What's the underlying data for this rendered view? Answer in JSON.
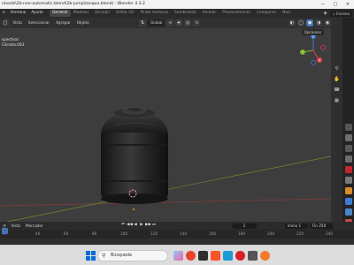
{
  "titlebar": {
    "title": "nloads\\2b-nee-automatic.blend\\2b-jump\\tanque.blend) - Blender 4.3.2",
    "minimize": "—",
    "maximize": "□",
    "close": "✕"
  },
  "menu": {
    "items": [
      "e",
      "Ventana",
      "Ayuda"
    ],
    "workspaces": [
      "General",
      "Modelar",
      "Esculpir",
      "Editar UV",
      "Pintar texturas",
      "Sombreado",
      "Animar",
      "Procesamiento",
      "Componer",
      "Nod"
    ],
    "active_workspace": "General",
    "scene": "Escena"
  },
  "viewport_header": {
    "menus": [
      "Vista",
      "Seleccionar",
      "Agregar",
      "Objeto"
    ],
    "transform": "Global",
    "options": "Opciones"
  },
  "viewport": {
    "info_line1": "spectival",
    "info_line2": "Cilindro.003",
    "axes": {
      "x": "X",
      "y": "Y",
      "z": "Z"
    }
  },
  "timeline": {
    "menus": [
      "Vista",
      "Marcador"
    ],
    "current_frame": "1",
    "start_label": "Inicio",
    "start": "1",
    "end_label": "Fin",
    "end": "250",
    "ruler": [
      "0",
      "40",
      "60",
      "80",
      "100",
      "120",
      "140",
      "160",
      "180",
      "200",
      "220",
      "240"
    ]
  },
  "taskbar": {
    "search_placeholder": "Búsqueda"
  },
  "colors": {
    "accent": "#4772b3",
    "axis_x": "#e2404f",
    "axis_y": "#7fb32a",
    "axis_z": "#3e7ad6"
  }
}
